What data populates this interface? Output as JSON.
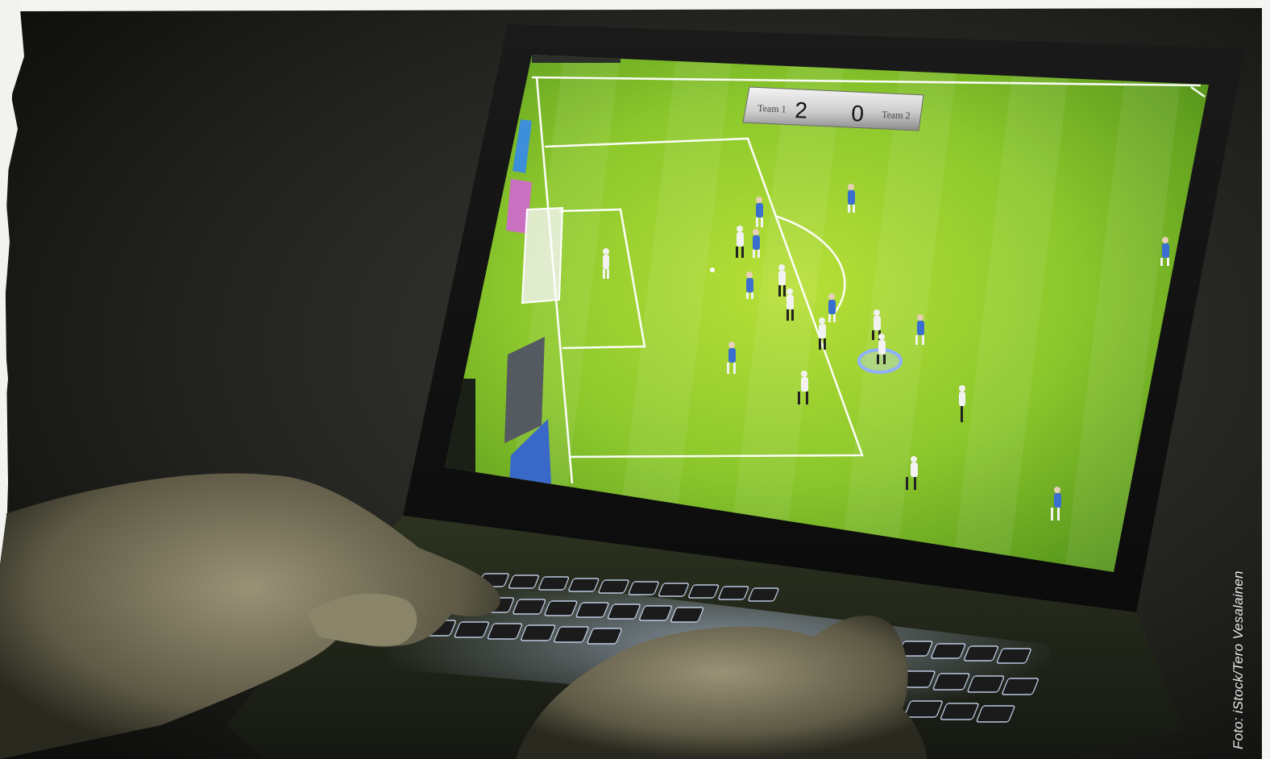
{
  "scoreboard": {
    "team1_label": "Team 1",
    "team1_score": "2",
    "team2_score": "0",
    "team2_label": "Team 2"
  },
  "photo_credit": "Foto: iStock/Tero Vesalainen",
  "colors": {
    "pitch_light": "#a8d430",
    "pitch_dark": "#5f9e1c",
    "laptop_body": "#141414",
    "key_backlight": "#cfe0ff",
    "team_blue": "#3a6fd0",
    "team_white": "#f2f2f2",
    "selection_ring": "#8fb0ff"
  }
}
